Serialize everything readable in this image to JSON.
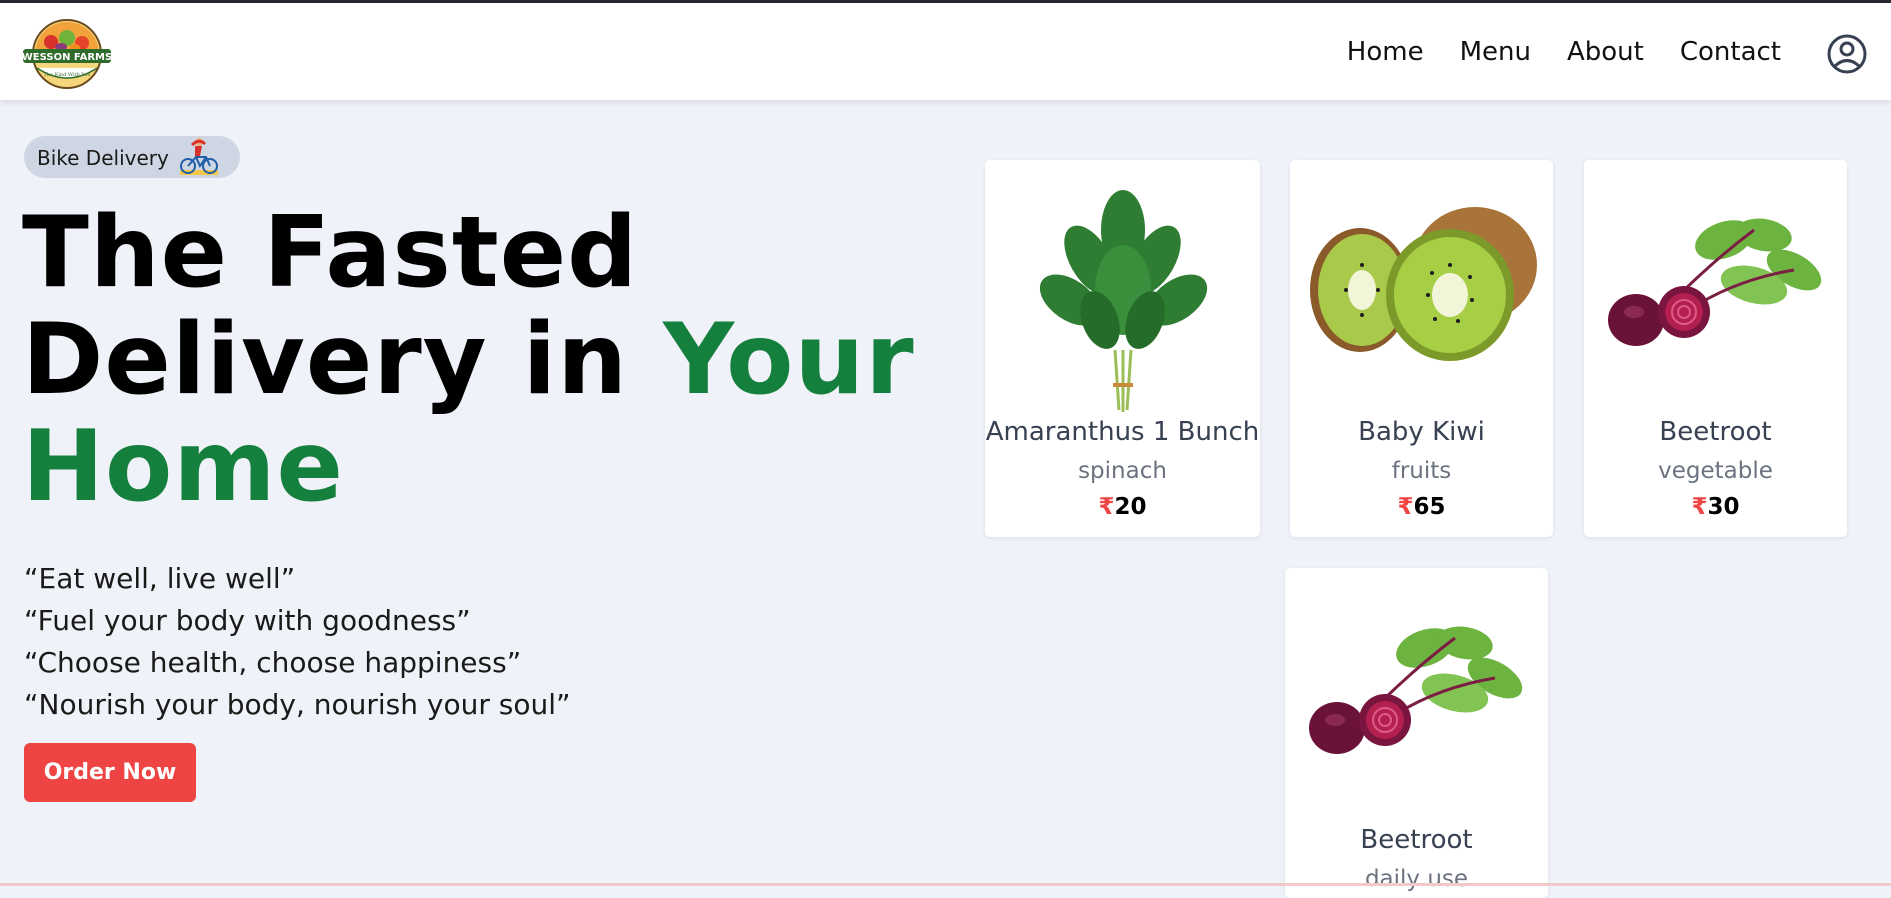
{
  "brand": {
    "logo_text_top": "WESSON FARMS",
    "logo_text_bottom": "The Kind With You"
  },
  "nav": {
    "items": [
      "Home",
      "Menu",
      "About",
      "Contact"
    ]
  },
  "hero": {
    "badge_label": "Bike Delivery",
    "headline_line1": "The Fasted",
    "headline_line2a": "Delivery in ",
    "headline_line2b": "Your",
    "headline_line3": "Home",
    "quotes": [
      "“Eat well, live well”",
      "“Fuel your body with goodness”",
      "“Choose health, choose happiness”",
      "“Nourish your body, nourish your soul”"
    ],
    "cta_label": "Order Now"
  },
  "products": [
    {
      "name": "Amaranthus 1 Bunch",
      "category": "spinach",
      "currency": "₹",
      "price": "20",
      "image": "spinach-image"
    },
    {
      "name": "Baby Kiwi",
      "category": "fruits",
      "currency": "₹",
      "price": "65",
      "image": "kiwi-image"
    },
    {
      "name": "Beetroot",
      "category": "vegetable",
      "currency": "₹",
      "price": "30",
      "image": "beetroot-image"
    },
    {
      "name": "Beetroot",
      "category": "daily use",
      "image": "beetroot-image"
    }
  ],
  "colors": {
    "accent_green": "#15803d",
    "cta_red": "#ef4444",
    "page_bg": "#eff2f8"
  }
}
